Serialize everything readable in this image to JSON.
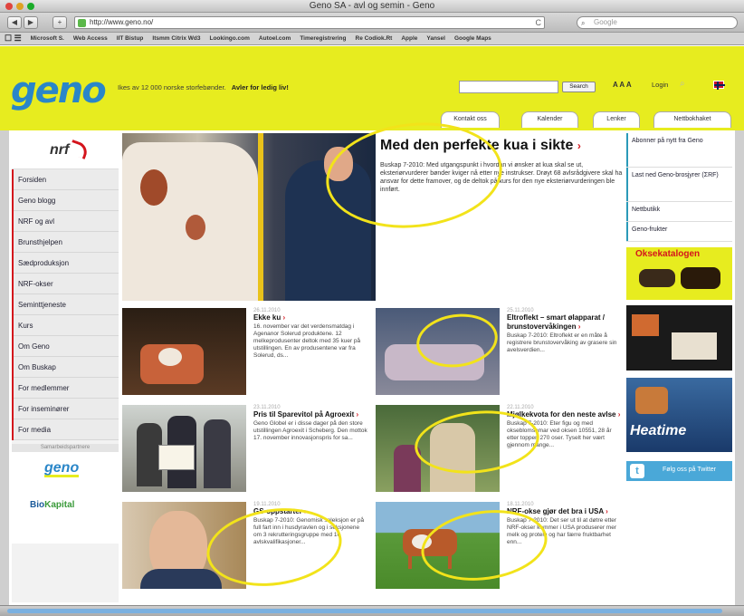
{
  "window": {
    "title": "Geno SA - avl og semin - Geno"
  },
  "toolbar": {
    "back": "◀",
    "forward": "▶",
    "add": "+",
    "url": "http://www.geno.no/",
    "reload": "C",
    "search_placeholder": "Google"
  },
  "bookmarks": [
    "Microsoft S.",
    "Web Access",
    "IIT Bistup",
    "Itsmm Citrix Wd3",
    "Lookingo.com",
    "Autoel.com",
    "Timeregistrering",
    "Re Codiok.Rt",
    "Apple",
    "Yansel",
    "Google Maps"
  ],
  "header": {
    "logo": "geno",
    "tagline": "Ikes av 12 000 norske storfebønder.",
    "tagline_link": "Avler for ledig liv!",
    "search_button": "Search",
    "text_size": "A A A",
    "login": "Login"
  },
  "tabs": [
    "Kontakt oss",
    "Kalender",
    "Lenker",
    "Nettbokhaket"
  ],
  "leftnav": {
    "logo": "nrf",
    "items": [
      "Forsiden",
      "Geno blogg",
      "NRF og avl",
      "Brunsthjelpen",
      "Sædproduksjon",
      "NRF-okser",
      "Seminttjeneste",
      "Kurs",
      "Om Geno",
      "Om Buskap",
      "For medlemmer",
      "For inseminører",
      "For media"
    ],
    "sponsor_label": "Samarbeidspartnere",
    "sponsor1": "geno",
    "sponsor2a": "Bio",
    "sponsor2b": "Kapital"
  },
  "hero": {
    "title": "Med den perfekte kua i sikte",
    "arrow": "›",
    "body": "Buskap 7-2010: Med utgangspunkt i hvordan vi ønsker at kua skal se ut, eksteriørvurderer bønder kviger nå etter nye instrukser. Drøyt 68 avlsrådgivere skal ha ansvar for dette framover, og de deltok på kurs for den nye eksteriørvurderingen ble innført."
  },
  "news": [
    {
      "date": "26.11.2010",
      "title": "Ekke ku",
      "arrow": "›",
      "body": "16. november var det verdensmatdag i Agenanor Solerud produktene. 12 melkeprodusenter deltok med 35 kuer på utstillingen. En av produsentene var fra Solerud, ds..."
    },
    {
      "date": "25.11.2010",
      "title": "Eltroflekt – smart ølapparat / brunstovervåkingen",
      "arrow": "›",
      "body": "Buskap 7-2010: Eltroflekt er en måte å registrere brunstovervåking av grasere sin avelsverdien..."
    },
    {
      "date": "23.11.2010",
      "title": "Pris til Sparevitol på Agroexit",
      "arrow": "›",
      "body": "Geno Globel er i disse dager på den store utstillingen Agroexit i Scheberg. Den mottok 17. november innovasjonspris for sa..."
    },
    {
      "date": "22.11.2010",
      "title": "Mjølkekvota for den neste avlse",
      "arrow": "›",
      "body": "Buskap 7-2010: Eter figu og med okseblomsamar ved oksen 10551, 28 år etter toppen 270 oser. Tyselt her vært gjennom mange..."
    },
    {
      "date": "19.11.2010",
      "title": "GS-oppstarter",
      "arrow": "›",
      "body": "Buskap 7-2010: Genomisk seleksjon er på full fart inn i husdyravlen og i seksjonene om 3 rekrutteringsgruppe med 16 avlskvalifikasjoner..."
    },
    {
      "date": "18.11.2010",
      "title": "NRF-okse gjør det bra i USA",
      "arrow": "›",
      "body": "Buskap 7-2010: Det ser ut til at døtre etter NRF-okser kommer i USA produserer mer melk og protein og har færre fruktbarhet enn..."
    }
  ],
  "rightcol": {
    "link1": "Abonner på nytt fra Geno",
    "link2": "Last ned Geno-brosjyrer (ΣRF)",
    "link3": "Nettbutikk",
    "link4": "Geno-frukter",
    "katalog": "Oksekatalogen",
    "heatime": "Heatime",
    "twitter_bird": "t",
    "twitter_text": "Følg oss på Twitter"
  }
}
